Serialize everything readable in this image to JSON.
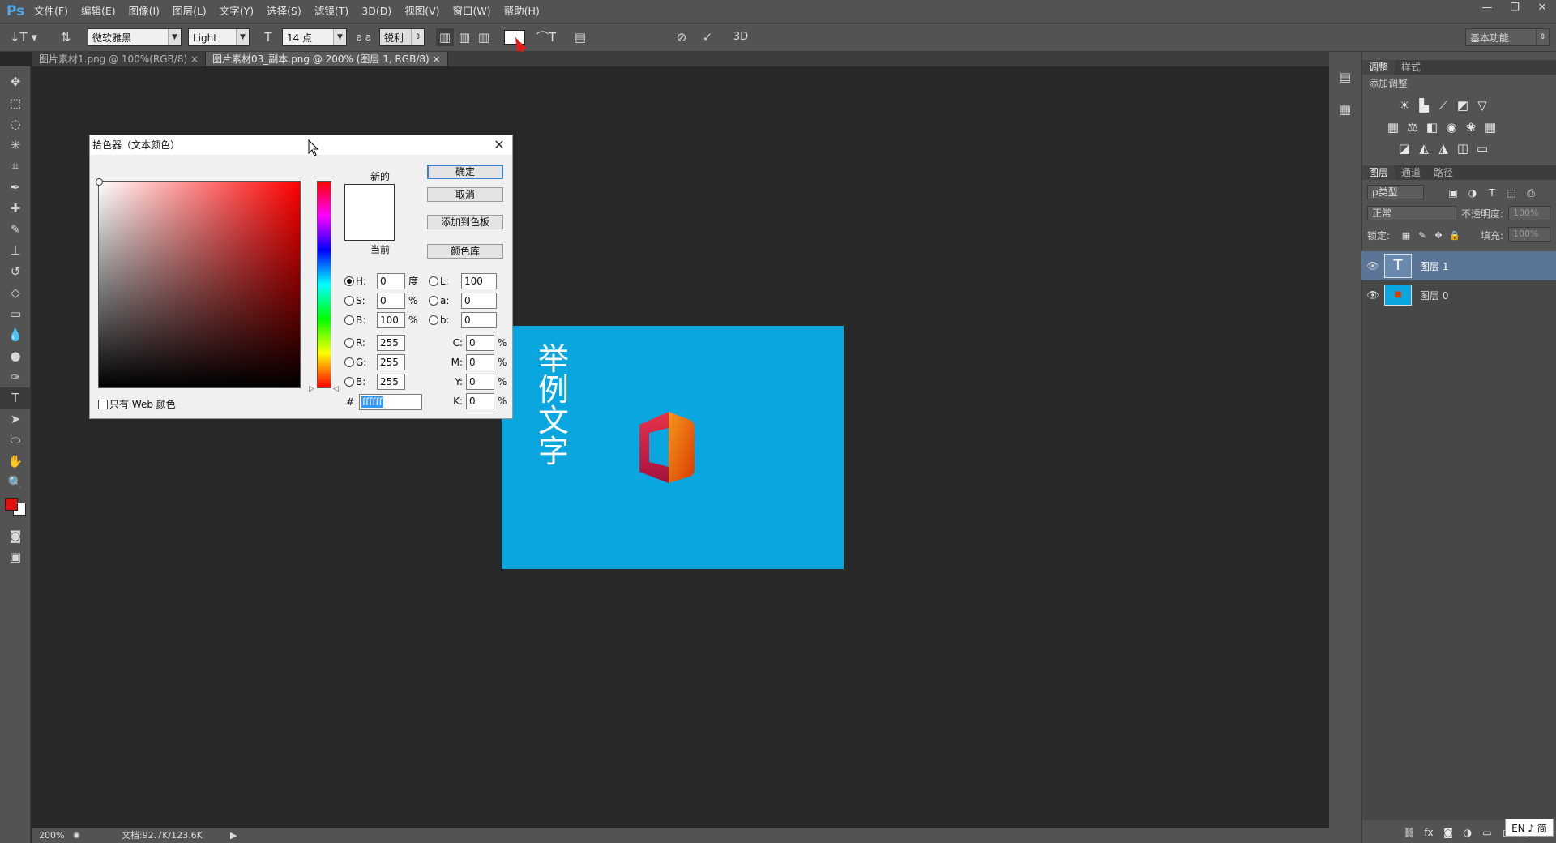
{
  "app": {
    "logo": "Ps"
  },
  "menu": [
    "文件(F)",
    "编辑(E)",
    "图像(I)",
    "图层(L)",
    "文字(Y)",
    "选择(S)",
    "滤镜(T)",
    "3D(D)",
    "视图(V)",
    "窗口(W)",
    "帮助(H)"
  ],
  "options": {
    "font_family": "微软雅黑",
    "font_style": "Light",
    "font_size": "14 点",
    "aa_label": "a a",
    "antialias": "锐利",
    "threed": "3D",
    "workspace": "基本功能"
  },
  "tabs": [
    {
      "label": "图片素材1.png @ 100%(RGB/8)",
      "close": "×"
    },
    {
      "label": "图片素材03_副本.png @ 200% (图层 1, RGB/8)",
      "close": "×"
    }
  ],
  "canvas_text": [
    "举",
    "例",
    "文",
    "字"
  ],
  "status": {
    "zoom": "200%",
    "doc": "文档:92.7K/123.6K"
  },
  "panels": {
    "adjust_tabs": [
      "调整",
      "样式"
    ],
    "adjust_title": "添加调整",
    "layer_tabs": [
      "图层",
      "通道",
      "路径"
    ],
    "kind_filter": "ρ类型",
    "blend_mode": "正常",
    "opacity_label": "不透明度:",
    "opacity_value": "100%",
    "lock_label": "锁定:",
    "fill_label": "填充:",
    "fill_value": "100%",
    "layers": [
      {
        "name": "图层 1",
        "type": "text",
        "selected": true
      },
      {
        "name": "图层 0",
        "type": "image",
        "selected": false
      }
    ],
    "ime": "EN ♪ 简"
  },
  "color_picker": {
    "title": "拾色器（文本颜色）",
    "new_label": "新的",
    "current_label": "当前",
    "ok": "确定",
    "cancel": "取消",
    "add_swatch": "添加到色板",
    "color_lib": "颜色库",
    "web_only": "只有 Web 颜色",
    "hsb": [
      {
        "label": "H:",
        "value": "0",
        "unit": "度",
        "checked": true
      },
      {
        "label": "S:",
        "value": "0",
        "unit": "%",
        "checked": false
      },
      {
        "label": "B:",
        "value": "100",
        "unit": "%",
        "checked": false
      }
    ],
    "rgb": [
      {
        "label": "R:",
        "value": "255"
      },
      {
        "label": "G:",
        "value": "255"
      },
      {
        "label": "B:",
        "value": "255"
      }
    ],
    "lab": [
      {
        "label": "L:",
        "value": "100"
      },
      {
        "label": "a:",
        "value": "0"
      },
      {
        "label": "b:",
        "value": "0"
      }
    ],
    "cmyk": [
      {
        "label": "C:",
        "value": "0",
        "unit": "%"
      },
      {
        "label": "M:",
        "value": "0",
        "unit": "%"
      },
      {
        "label": "Y:",
        "value": "0",
        "unit": "%"
      },
      {
        "label": "K:",
        "value": "0",
        "unit": "%"
      }
    ],
    "hex_label": "#",
    "hex": "ffffff"
  },
  "colors": {
    "canvas_blue": "#0aa6e0",
    "foreground": "#e01010",
    "background": "#ffffff",
    "text_color": "#ffffff"
  }
}
